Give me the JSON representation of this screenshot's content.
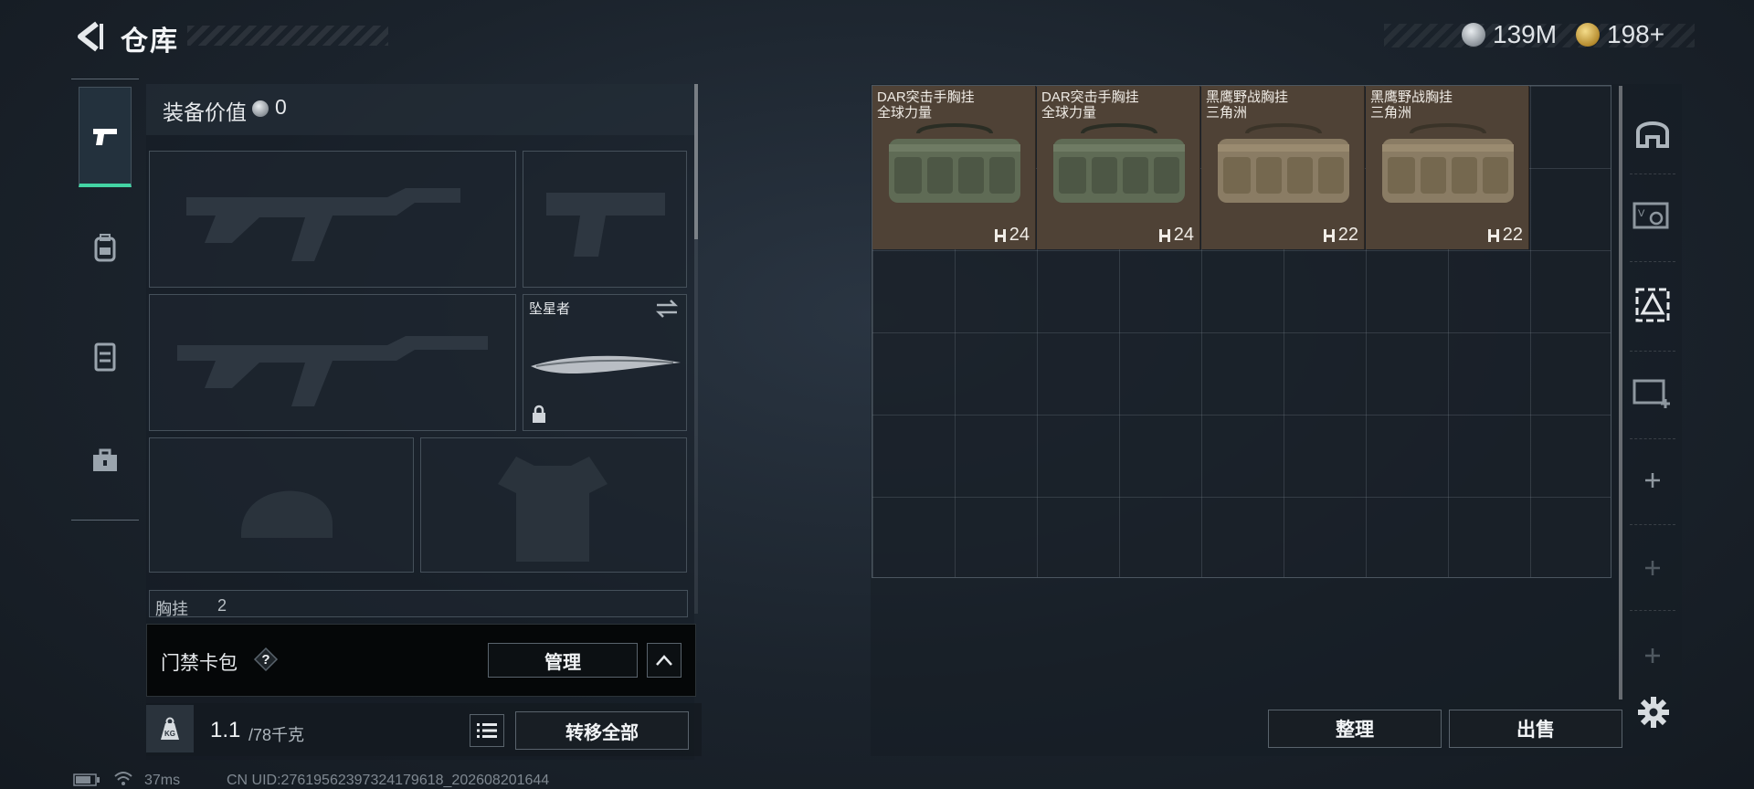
{
  "header": {
    "title": "仓库",
    "currency_silver": "139M",
    "currency_gold": "198+"
  },
  "left_nav": {
    "items": [
      {
        "icon": "pistol-icon",
        "active": true
      },
      {
        "icon": "backpack-icon",
        "active": false
      },
      {
        "icon": "vest-icon",
        "active": false
      },
      {
        "icon": "toolbox-icon",
        "active": false
      }
    ]
  },
  "equipment": {
    "value_label": "装备价值",
    "value": "0",
    "melee_name": "坠星者",
    "chest_rig_label": "胸挂",
    "chest_rig_count": "2"
  },
  "card_pack": {
    "label": "门禁卡包",
    "help_icon": "?",
    "manage_label": "管理"
  },
  "footer": {
    "weight_current": "1.1",
    "weight_max": "/78千克",
    "weight_icon_label": "KG",
    "transfer_all_label": "转移全部",
    "ping": "37ms",
    "uid": "CN UID:27619562397324179618_202608201644"
  },
  "storage": {
    "items": [
      {
        "line1": "DAR突击手胸挂",
        "line2": "全球力量",
        "count": "24",
        "tint": "green"
      },
      {
        "line1": "DAR突击手胸挂",
        "line2": "全球力量",
        "count": "24",
        "tint": "green"
      },
      {
        "line1": "黑鹰野战胸挂",
        "line2": "三角洲",
        "count": "22",
        "tint": "tan"
      },
      {
        "line1": "黑鹰野战胸挂",
        "line2": "三角洲",
        "count": "22",
        "tint": "tan"
      }
    ],
    "arrange_label": "整理",
    "sell_label": "出售"
  },
  "right_nav": {
    "items": [
      "helmet-slot-icon",
      "map-card-icon",
      "stash-box-icon",
      "add-slot-icon",
      "plus-icon",
      "plus-icon",
      "plus-icon"
    ],
    "settings_icon": "gear-icon"
  },
  "colors": {
    "accent_green": "#43d4a4",
    "item_bg": "#4f4236"
  }
}
